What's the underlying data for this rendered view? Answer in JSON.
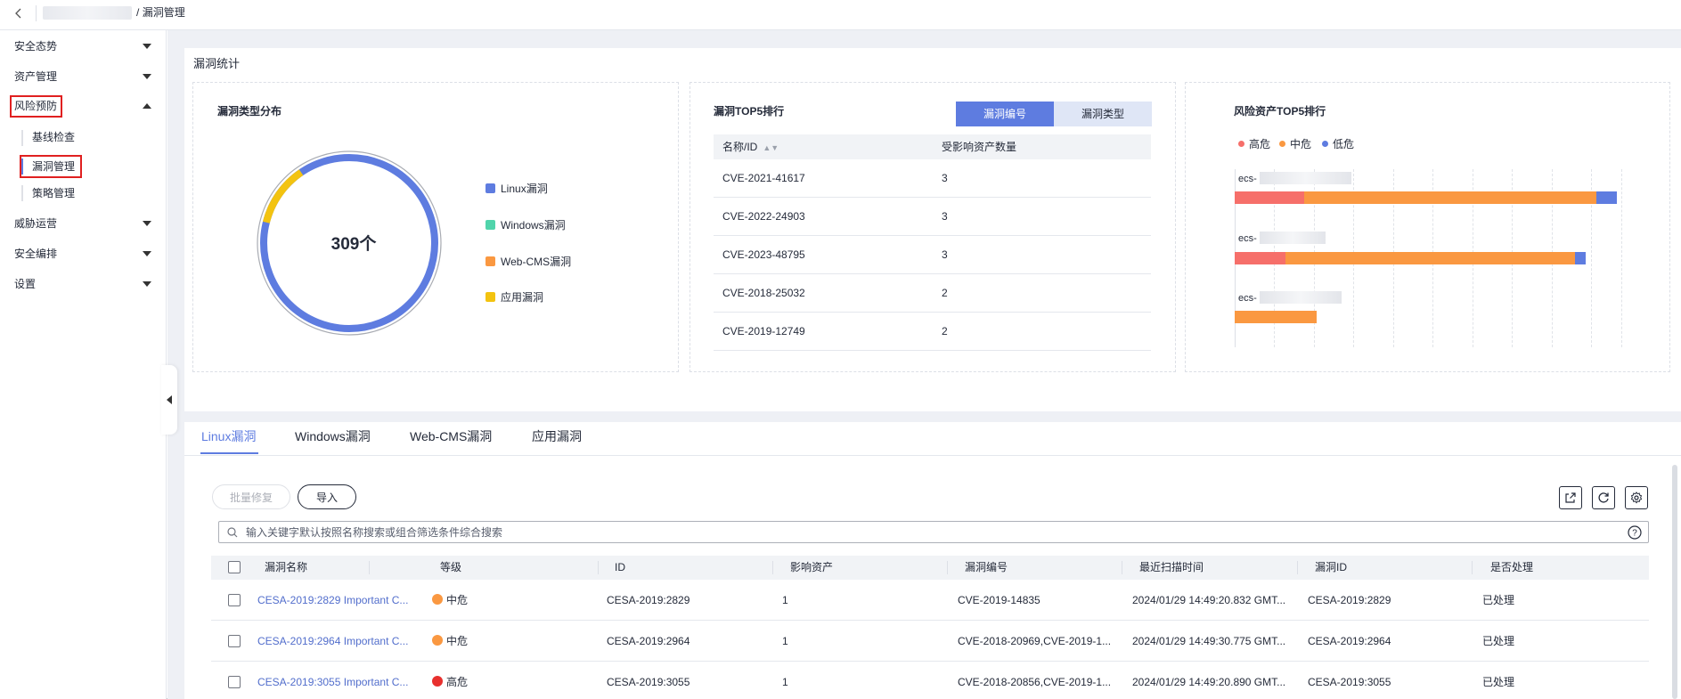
{
  "breadcrumb": {
    "current": "漏洞管理",
    "separator": "/"
  },
  "sidebar": {
    "items": [
      {
        "label": "安全态势",
        "expanded": false
      },
      {
        "label": "资产管理",
        "expanded": false
      },
      {
        "label": "风险预防",
        "expanded": true,
        "children": [
          {
            "label": "基线检查"
          },
          {
            "label": "漏洞管理",
            "active": true
          },
          {
            "label": "策略管理"
          }
        ]
      },
      {
        "label": "威胁运营",
        "expanded": false
      },
      {
        "label": "安全编排",
        "expanded": false
      },
      {
        "label": "设置",
        "expanded": false
      }
    ]
  },
  "stats": {
    "title": "漏洞统计",
    "type_dist": {
      "title": "漏洞类型分布",
      "total_label": "309个",
      "legend": [
        {
          "label": "Linux漏洞",
          "color": "#5e7ce0"
        },
        {
          "label": "Windows漏洞",
          "color": "#50d4ab"
        },
        {
          "label": "Web-CMS漏洞",
          "color": "#fa9841"
        },
        {
          "label": "应用漏洞",
          "color": "#f3c310"
        }
      ]
    },
    "top5": {
      "title": "漏洞TOP5排行",
      "tabs": [
        "漏洞编号",
        "漏洞类型"
      ],
      "columns": [
        "名称/ID",
        "受影响资产数量"
      ],
      "rows": [
        {
          "id": "CVE-2021-41617",
          "count": "3"
        },
        {
          "id": "CVE-2022-24903",
          "count": "3"
        },
        {
          "id": "CVE-2023-48795",
          "count": "3"
        },
        {
          "id": "CVE-2018-25032",
          "count": "2"
        },
        {
          "id": "CVE-2019-12749",
          "count": "2"
        }
      ]
    },
    "risk_assets": {
      "title": "风险资产TOP5排行",
      "legend": [
        {
          "label": "高危",
          "color": "#f66f6a"
        },
        {
          "label": "中危",
          "color": "#fa9841"
        },
        {
          "label": "低危",
          "color": "#5e7ce0"
        }
      ],
      "assets": [
        {
          "label": "ecs-"
        },
        {
          "label": "ecs-"
        },
        {
          "label": "ecs-"
        }
      ]
    }
  },
  "tabs": [
    "Linux漏洞",
    "Windows漏洞",
    "Web-CMS漏洞",
    "应用漏洞"
  ],
  "toolbar": {
    "batch_fix": "批量修复",
    "import": "导入"
  },
  "search": {
    "placeholder": "输入关键字默认按照名称搜索或组合筛选条件综合搜索"
  },
  "table": {
    "columns": [
      "漏洞名称",
      "等级",
      "ID",
      "影响资产",
      "漏洞编号",
      "最近扫描时间",
      "漏洞ID",
      "是否处理"
    ],
    "rows": [
      {
        "name": "CESA-2019:2829 Important C...",
        "level": "中危",
        "level_color": "#fa9841",
        "id": "CESA-2019:2829",
        "assets": "1",
        "cve": "CVE-2019-14835",
        "time": "2024/01/29 14:49:20.832 GMT...",
        "vuln_id": "CESA-2019:2829",
        "handled": "已处理"
      },
      {
        "name": "CESA-2019:2964 Important C...",
        "level": "中危",
        "level_color": "#fa9841",
        "id": "CESA-2019:2964",
        "assets": "1",
        "cve": "CVE-2018-20969,CVE-2019-1...",
        "time": "2024/01/29 14:49:30.775 GMT...",
        "vuln_id": "CESA-2019:2964",
        "handled": "已处理"
      },
      {
        "name": "CESA-2019:3055 Important C...",
        "level": "高危",
        "level_color": "#e8302e",
        "id": "CESA-2019:3055",
        "assets": "1",
        "cve": "CVE-2018-20856,CVE-2019-1...",
        "time": "2024/01/29 14:49:20.890 GMT...",
        "vuln_id": "CESA-2019:3055",
        "handled": "已处理"
      }
    ]
  }
}
